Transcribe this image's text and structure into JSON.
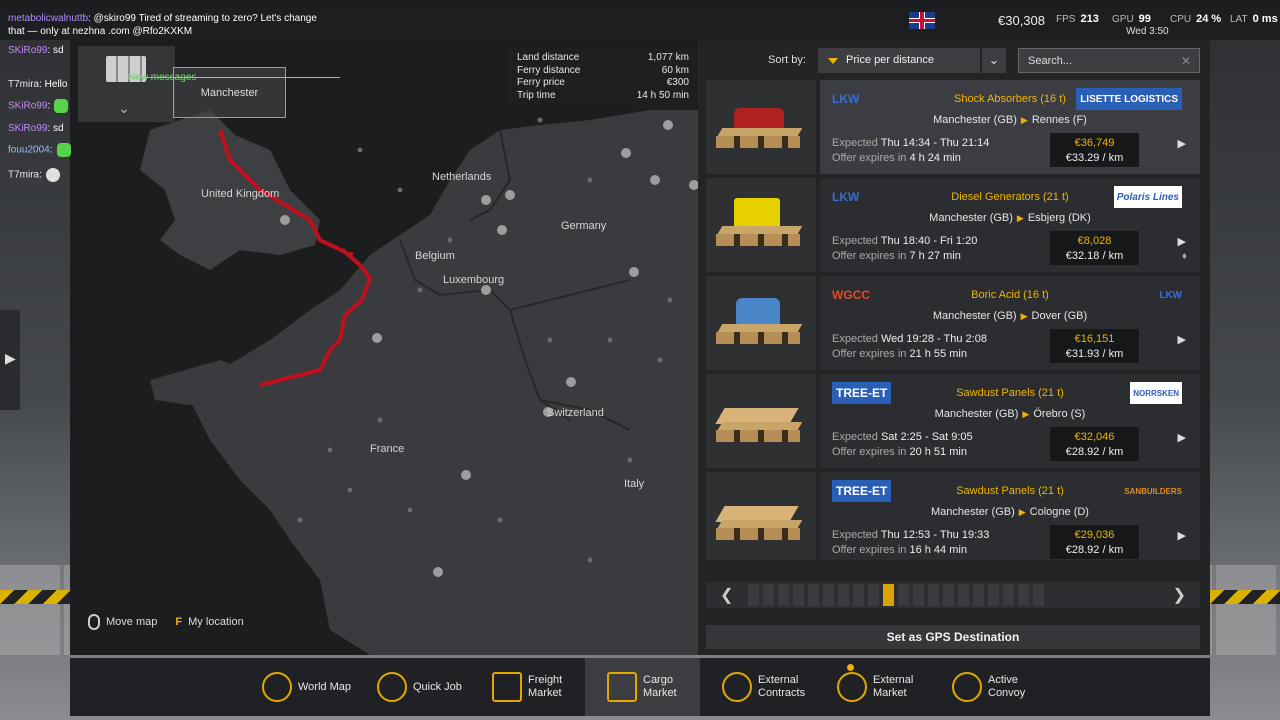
{
  "topbar": {
    "money": "€30,308",
    "fps_label": "FPS",
    "fps_value": "213",
    "gpu_label": "GPU",
    "gpu_value": "99",
    "cpu_label": "CPU",
    "cpu_value": "24 %",
    "lat_label": "LAT",
    "lat_value": "0 ms",
    "clock": "Wed 3:50"
  },
  "chat": {
    "new_messages": "New messages",
    "lines": [
      {
        "user": "metabolicwalnuttb",
        "text": ": @skiro99 Tired of streaming to zero? Let's change"
      },
      {
        "user": "",
        "text": "that — only at nezhna .com @Rfo2KXKM"
      },
      {
        "user": "SKiRo99",
        "text": ": sd"
      },
      {
        "user": "T7mira",
        "text": ": Hello"
      },
      {
        "user": "SKiRo99",
        "text": ":"
      },
      {
        "user": "SKiRo99",
        "text": ": sd"
      },
      {
        "user": "fouu2004",
        "text": ":"
      },
      {
        "user": "T7mira",
        "text": ":"
      }
    ]
  },
  "map": {
    "origin_city": "Manchester",
    "countries": [
      "United Kingdom",
      "Netherlands",
      "Belgium",
      "Germany",
      "Luxembourg",
      "France",
      "Switzerland",
      "Italy"
    ],
    "trip": {
      "land_distance_label": "Land distance",
      "land_distance": "1,077 km",
      "ferry_distance_label": "Ferry distance",
      "ferry_distance": "60 km",
      "ferry_price_label": "Ferry price",
      "ferry_price": "€300",
      "trip_duration_label": "Trip time",
      "trip_duration": "14 h 50 min"
    },
    "move_map_label": "Move map",
    "location_key": "F",
    "my_location_label": "My location"
  },
  "sort": {
    "label": "Sort by:",
    "selected": "Price per distance",
    "search_placeholder": "Search..."
  },
  "offers": [
    {
      "left_logo": "LKW",
      "cargo": "Shock Absorbers (16 t)",
      "right_logo": "LISETTE LOGISTICS",
      "from": "Manchester (GB)",
      "to": "Rennes (F)",
      "expected_label": "Expected",
      "expected": "Thu 14:34 - Thu 21:14",
      "expires_label": "Offer expires in",
      "expires": "4 h 24 min",
      "price": "€36,749",
      "per_km": "€33.29 / km"
    },
    {
      "left_logo": "LKW",
      "cargo": "Diesel Generators (21 t)",
      "right_logo": "Polaris Lines",
      "from": "Manchester (GB)",
      "to": "Esbjerg (DK)",
      "expected_label": "Expected",
      "expected": "Thu 18:40 - Fri 1:20",
      "expires_label": "Offer expires in",
      "expires": "7 h 27 min",
      "price": "€8,028",
      "per_km": "€32.18 / km"
    },
    {
      "left_logo": "WGCC",
      "cargo": "Boric Acid (16 t)",
      "right_logo": "LKW",
      "from": "Manchester (GB)",
      "to": "Dover (GB)",
      "expected_label": "Expected",
      "expected": "Wed 19:28 - Thu 2:08",
      "expires_label": "Offer expires in",
      "expires": "21 h 55 min",
      "price": "€16,151",
      "per_km": "€31.93 / km"
    },
    {
      "left_logo": "TREE-ET",
      "cargo": "Sawdust Panels (21 t)",
      "right_logo": "NORRSKEN",
      "from": "Manchester (GB)",
      "to": "Örebro (S)",
      "expected_label": "Expected",
      "expected": "Sat 2:25 - Sat 9:05",
      "expires_label": "Offer expires in",
      "expires": "20 h 51 min",
      "price": "€32,046",
      "per_km": "€28.92 / km"
    },
    {
      "left_logo": "TREE-ET",
      "cargo": "Sawdust Panels (21 t)",
      "right_logo": "SANBUILDERS",
      "from": "Manchester (GB)",
      "to": "Cologne (D)",
      "expected_label": "Expected",
      "expected": "Thu 12:53 - Thu 19:33",
      "expires_label": "Offer expires in",
      "expires": "16 h 44 min",
      "price": "€29,036",
      "per_km": "€28.92 / km"
    }
  ],
  "gps_button": "Set as GPS Destination",
  "bottom_nav": [
    {
      "label1": "World Map",
      "label2": "",
      "icon": "world-map-icon"
    },
    {
      "label1": "Quick Job",
      "label2": "",
      "icon": "quick-job-icon"
    },
    {
      "label1": "Freight",
      "label2": "Market",
      "icon": "freight-market-icon"
    },
    {
      "label1": "Cargo",
      "label2": "Market",
      "icon": "cargo-market-icon"
    },
    {
      "label1": "External",
      "label2": "Contracts",
      "icon": "external-contracts-icon"
    },
    {
      "label1": "External",
      "label2": "Market",
      "icon": "external-market-icon"
    },
    {
      "label1": "Active",
      "label2": "Convoy",
      "icon": "active-convoy-icon"
    }
  ],
  "colors": {
    "accent": "#f0b400",
    "route": "#c0101e",
    "panel": "#232426"
  }
}
